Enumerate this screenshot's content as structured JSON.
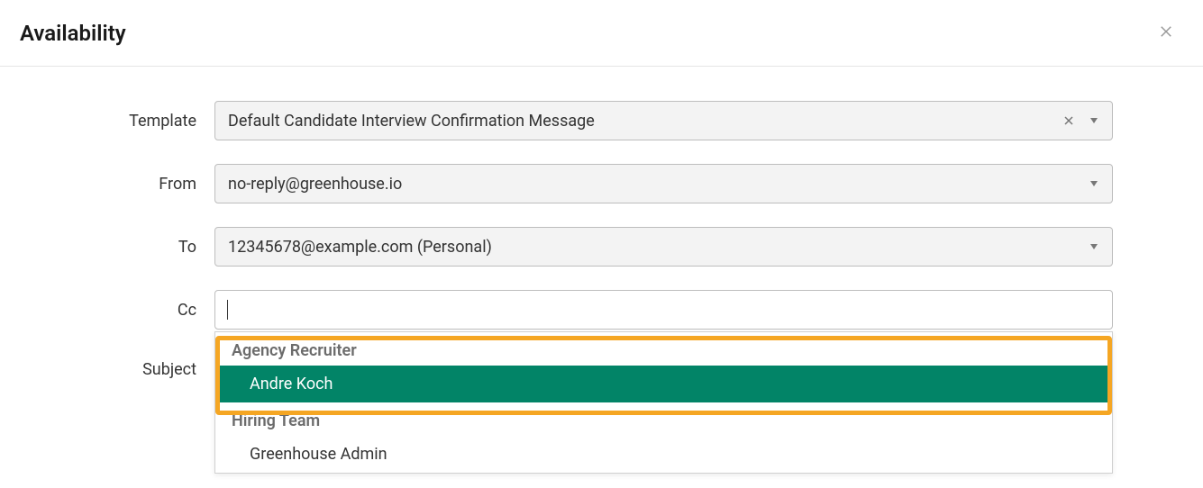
{
  "header": {
    "title": "Availability"
  },
  "form": {
    "template": {
      "label": "Template",
      "value": "Default Candidate Interview Confirmation Message"
    },
    "from": {
      "label": "From",
      "value": "no-reply@greenhouse.io"
    },
    "to": {
      "label": "To",
      "value": "12345678@example.com (Personal)"
    },
    "cc": {
      "label": "Cc",
      "value": ""
    },
    "subject": {
      "label": "Subject"
    }
  },
  "dropdown": {
    "group1": {
      "label": "Agency Recruiter",
      "option": "Andre Koch"
    },
    "group2": {
      "label": "Hiring Team",
      "option": "Greenhouse Admin"
    }
  }
}
